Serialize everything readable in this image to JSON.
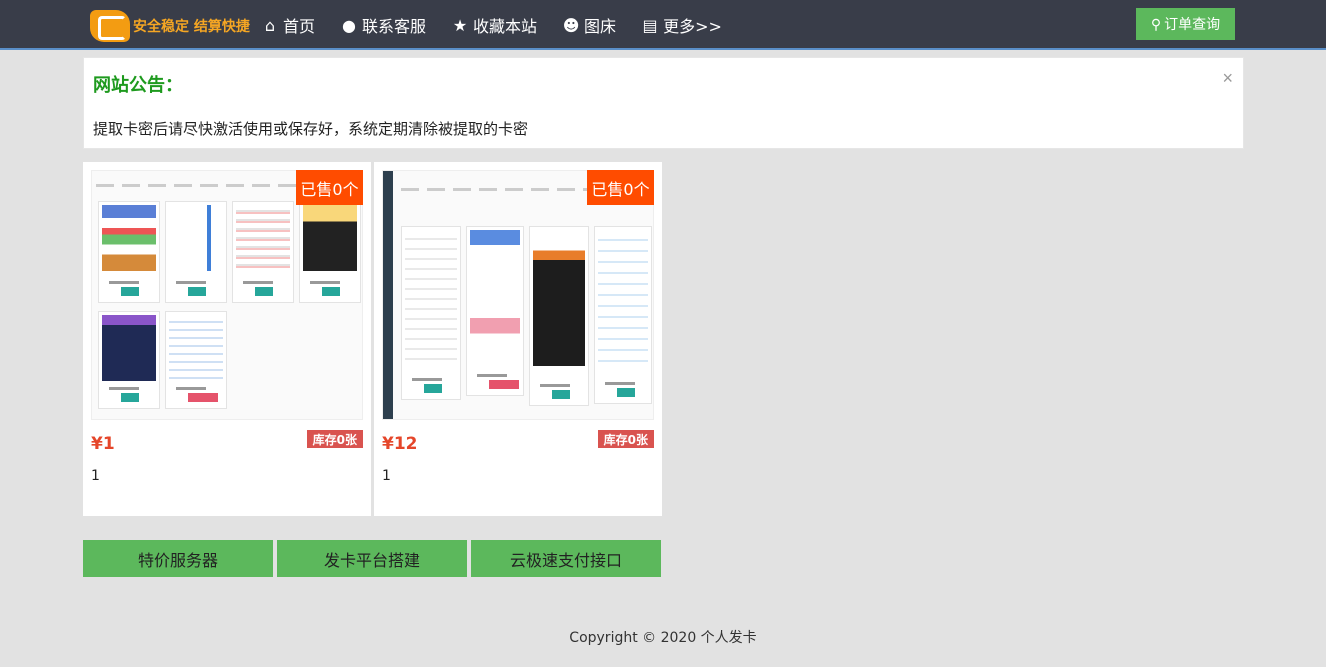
{
  "navbar": {
    "logo_text": "安全稳定 结算快捷",
    "links": [
      {
        "label": "首页",
        "icon": "home-icon"
      },
      {
        "label": "联系客服",
        "icon": "qq-icon"
      },
      {
        "label": "收藏本站",
        "icon": "star-icon"
      },
      {
        "label": "图床",
        "icon": "users-icon"
      },
      {
        "label": "更多>>",
        "icon": "list-icon"
      }
    ],
    "order_label": "订单查询"
  },
  "notice": {
    "title": "网站公告：",
    "close": "×",
    "body": "提取卡密后请尽快激活使用或保存好，系统定期清除被提取的卡密"
  },
  "products": [
    {
      "sold": "已售0个",
      "price": "¥1",
      "stock": "库存0张",
      "desc": "1"
    },
    {
      "sold": "已售0个",
      "price": "¥12",
      "stock": "库存0张",
      "desc": "1"
    }
  ],
  "links": [
    "特价服务器",
    "发卡平台搭建",
    "云极速支付接口"
  ],
  "footer": "Copyright © 2020 个人发卡",
  "colors": {
    "navbar": "#393d49",
    "accent_green": "#5cb85c",
    "badge": "#ff4c00",
    "price": "#e5462a",
    "stock": "#d9534f"
  }
}
